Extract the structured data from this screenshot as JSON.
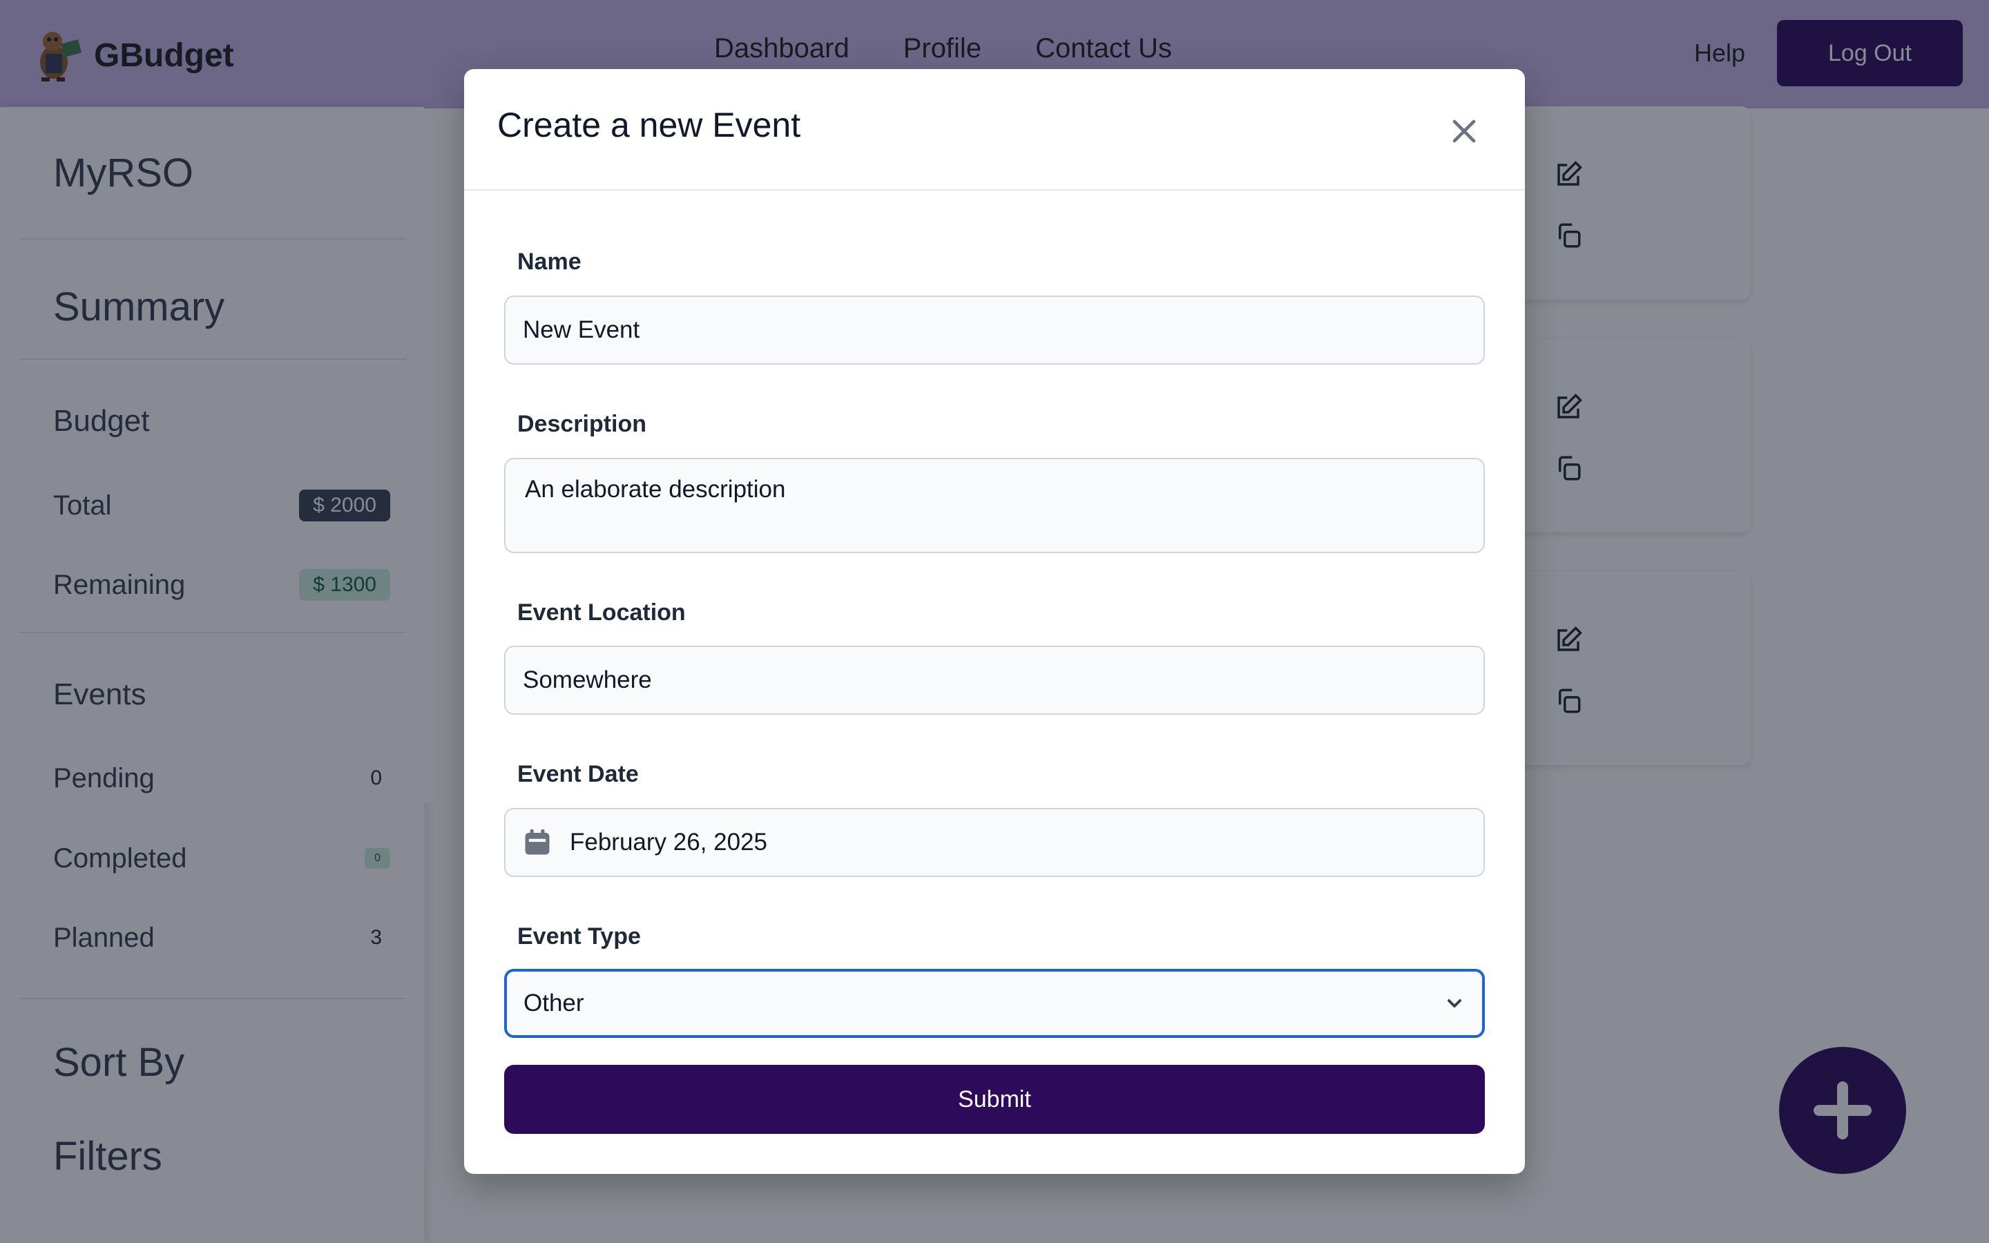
{
  "app": {
    "name": "GBudget"
  },
  "nav": {
    "items": [
      "Dashboard",
      "Profile",
      "Contact Us"
    ],
    "help": "Help",
    "logout": "Log Out"
  },
  "sidebar": {
    "title": "MyRSO",
    "summary": "Summary",
    "budget": {
      "heading": "Budget",
      "total_label": "Total",
      "total_value": "$ 2000",
      "remaining_label": "Remaining",
      "remaining_value": "$ 1300"
    },
    "events": {
      "heading": "Events",
      "pending_label": "Pending",
      "pending_value": "0",
      "completed_label": "Completed",
      "completed_value": "0",
      "planned_label": "Planned",
      "planned_value": "3"
    },
    "sort_by": "Sort By",
    "filters": "Filters"
  },
  "modal": {
    "title": "Create a new Event",
    "name_label": "Name",
    "name_value": "New Event",
    "description_label": "Description",
    "description_value": "An elaborate description",
    "location_label": "Event Location",
    "location_value": "Somewhere",
    "date_label": "Event Date",
    "date_value": "February 26, 2025",
    "type_label": "Event Type",
    "type_value": "Other",
    "submit": "Submit"
  },
  "icons": {
    "close": "close-icon",
    "calendar": "calendar-icon",
    "chevron": "chevron-down-icon",
    "edit": "edit-icon",
    "copy": "copy-icon",
    "add": "plus-icon"
  },
  "colors": {
    "primary": "#2d0b5a",
    "topbar": "#c6b5e6",
    "focus": "#1f63d6",
    "badge_dark": "#3a4256",
    "badge_green": "#cbeedd"
  }
}
